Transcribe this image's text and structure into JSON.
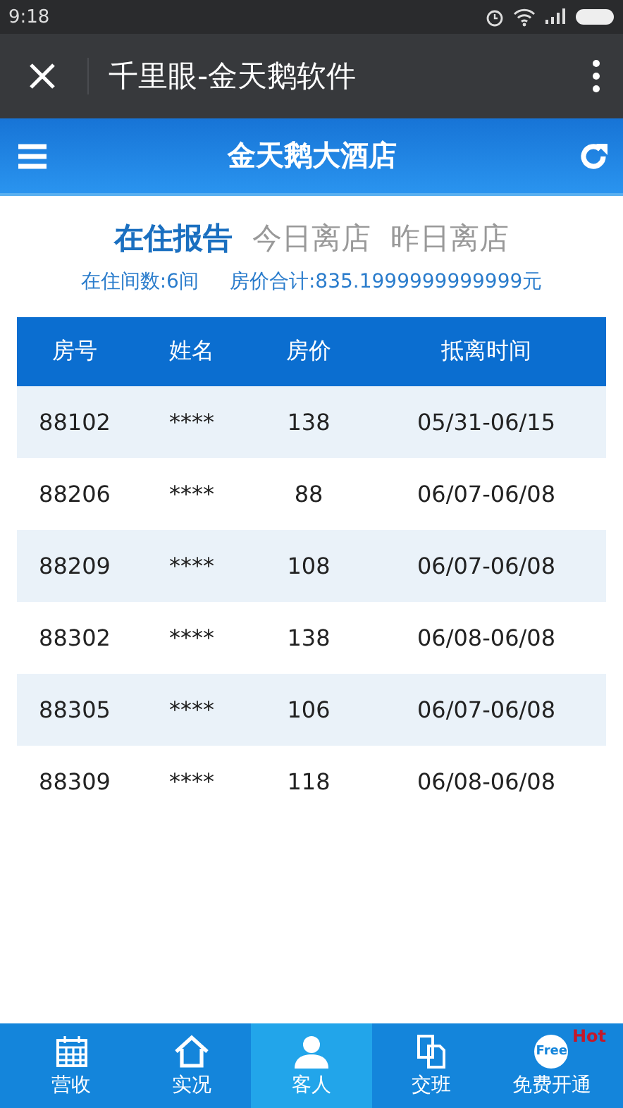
{
  "status_bar": {
    "time": "9:18"
  },
  "window": {
    "title": "千里眼-金天鹅软件"
  },
  "header": {
    "title": "金天鹅大酒店"
  },
  "tabs": [
    {
      "label": "在住报告",
      "selected": true
    },
    {
      "label": "今日离店",
      "selected": false
    },
    {
      "label": "昨日离店",
      "selected": false
    }
  ],
  "summary": {
    "rooms": "在住间数:6间",
    "total": "房价合计:835.1999999999999元"
  },
  "table": {
    "columns": [
      "房号",
      "姓名",
      "房价",
      "抵离时间"
    ],
    "rows": [
      [
        "88102",
        "****",
        "138",
        "05/31-06/15"
      ],
      [
        "88206",
        "****",
        "88",
        "06/07-06/08"
      ],
      [
        "88209",
        "****",
        "108",
        "06/07-06/08"
      ],
      [
        "88302",
        "****",
        "138",
        "06/08-06/08"
      ],
      [
        "88305",
        "****",
        "106",
        "06/07-06/08"
      ],
      [
        "88309",
        "****",
        "118",
        "06/08-06/08"
      ]
    ]
  },
  "nav": [
    {
      "label": "营收",
      "kind": "calendar",
      "selected": false
    },
    {
      "label": "实况",
      "kind": "home",
      "selected": false
    },
    {
      "label": "客人",
      "kind": "person",
      "selected": true
    },
    {
      "label": "交班",
      "kind": "pages",
      "selected": false
    },
    {
      "label": "免费开通",
      "kind": "free",
      "selected": false,
      "badge": "Hot",
      "icon_text": "Free"
    }
  ]
}
